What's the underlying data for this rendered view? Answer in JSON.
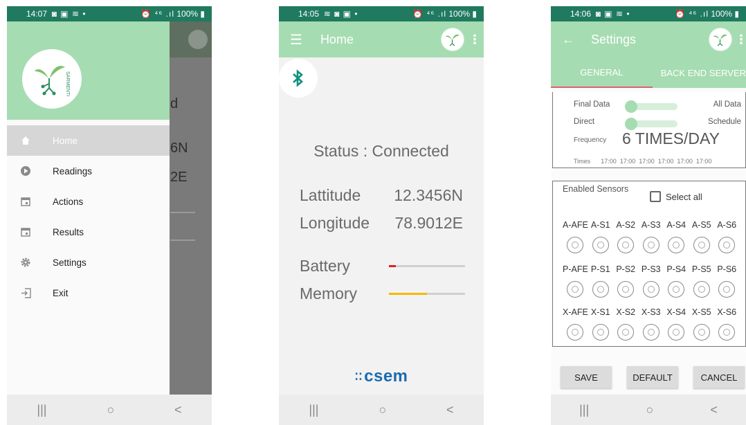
{
  "phone1": {
    "status": {
      "time": "14:07",
      "left_icons": "◙ ▣ ≋ •",
      "right_icons": "⏰ ⁴⁶ .ıl",
      "battery": "100%"
    },
    "background_text": {
      "line1": "d",
      "line2": "6N",
      "line3": "2E"
    },
    "brand": "SARMENTI",
    "menu": [
      {
        "label": "Home",
        "icon": "home-icon"
      },
      {
        "label": "Readings",
        "icon": "play-circle-icon"
      },
      {
        "label": "Actions",
        "icon": "calendar-icon"
      },
      {
        "label": "Results",
        "icon": "calendar-icon"
      },
      {
        "label": "Settings",
        "icon": "gear-icon"
      },
      {
        "label": "Exit",
        "icon": "exit-icon"
      }
    ]
  },
  "phone2": {
    "status": {
      "time": "14:05",
      "left_icons": "≋ ◙ ▣ •",
      "right_icons": "⏰ ⁴⁶ .ıl",
      "battery": "100%"
    },
    "title": "Home",
    "status_line": "Status : Connected",
    "latitude_label": "Lattitude",
    "latitude_value": "12.3456N",
    "longitude_label": "Longitude",
    "longitude_value": "78.9012E",
    "battery_label": "Battery",
    "battery_level": 0.09,
    "memory_label": "Memory",
    "memory_level": 0.5,
    "footer_logo": "csem",
    "colors": {
      "battery": "#e02020",
      "memory": "#f5b800",
      "accent": "#a6dcb1"
    }
  },
  "phone3": {
    "status": {
      "time": "14:06",
      "left_icons": "◙ ▣ ≋ •",
      "right_icons": "⏰ ⁴⁶ .ıl",
      "battery": "100%"
    },
    "title": "Settings",
    "tabs": [
      "GENERAL",
      "BACK END SERVER"
    ],
    "toggle1_left": "Final Data",
    "toggle1_right": "All Data",
    "toggle2_left": "Direct",
    "toggle2_right": "Schedule",
    "frequency_label": "Frequency",
    "frequency_value": "6 TIMES/DAY",
    "times_label": "Times",
    "times": [
      "17:00",
      "17:00",
      "17:00",
      "17:00",
      "17:00",
      "17:00"
    ],
    "enabled_sensors_label": "Enabled Sensors",
    "select_all_label": "Select all",
    "sensor_rows": [
      [
        "A-AFE",
        "A-S1",
        "A-S2",
        "A-S3",
        "A-S4",
        "A-S5",
        "A-S6"
      ],
      [
        "P-AFE",
        "P-S1",
        "P-S2",
        "P-S3",
        "P-S4",
        "P-S5",
        "P-S6"
      ],
      [
        "X-AFE",
        "X-S1",
        "X-S2",
        "X-S3",
        "X-S4",
        "X-S5",
        "X-S6"
      ]
    ],
    "buttons": {
      "save": "SAVE",
      "default": "DEFAULT",
      "cancel": "CANCEL"
    }
  },
  "navbar": {
    "recents": "|||",
    "home": "○",
    "back": "<"
  }
}
